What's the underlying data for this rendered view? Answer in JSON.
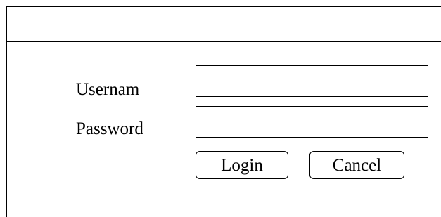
{
  "form": {
    "username_label": "Usernam",
    "password_label": "Password",
    "username_value": "",
    "password_value": ""
  },
  "buttons": {
    "login_label": "Login",
    "cancel_label": "Cancel"
  }
}
